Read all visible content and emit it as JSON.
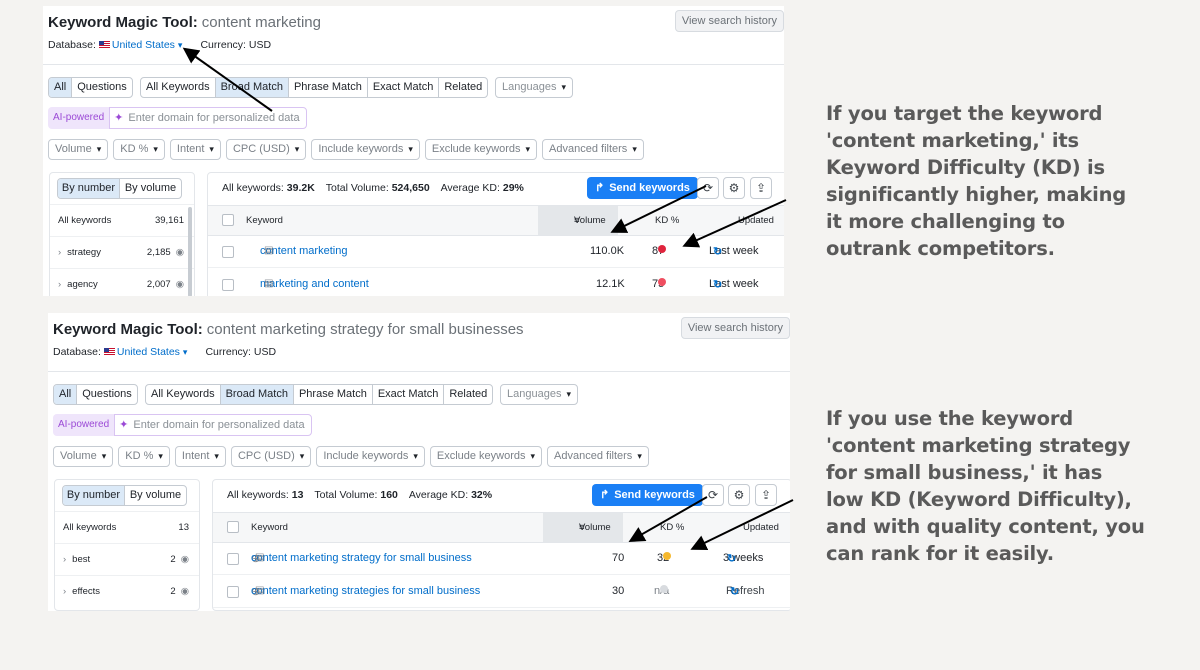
{
  "panels": [
    {
      "title": "Keyword Magic Tool:",
      "query": "content marketing",
      "history_button": "View search history",
      "database_label": "Database:",
      "database_value": "United States",
      "currency": "Currency: USD",
      "match_tabs_a": [
        "All",
        "Questions"
      ],
      "match_tabs_b": [
        "All Keywords",
        "Broad Match",
        "Phrase Match",
        "Exact Match",
        "Related"
      ],
      "languages": "Languages",
      "ai_badge": "AI-powered",
      "ai_placeholder": "Enter domain for personalized data",
      "filters": [
        "Volume",
        "KD %",
        "Intent",
        "CPC (USD)",
        "Include keywords",
        "Exclude keywords",
        "Advanced filters"
      ],
      "toggle": [
        "By number",
        "By volume"
      ],
      "side_rows": [
        {
          "label": "All keywords",
          "count": "39,161",
          "expandable": false
        },
        {
          "label": "strategy",
          "count": "2,185",
          "expandable": true
        },
        {
          "label": "agency",
          "count": "2,007",
          "expandable": true
        }
      ],
      "summary": {
        "all_label": "All keywords:",
        "all_value": "39.2K",
        "vol_label": "Total Volume:",
        "vol_value": "524,650",
        "kd_label": "Average KD:",
        "kd_value": "29%"
      },
      "send_button": "Send keywords",
      "columns": {
        "keyword": "Keyword",
        "volume": "Volume",
        "kd": "KD %",
        "updated": "Updated"
      },
      "rows": [
        {
          "keyword": "content marketing",
          "volume": "110.0K",
          "kd": "87",
          "kd_color": "#e0243d",
          "updated": "Last week"
        },
        {
          "keyword": "marketing and content",
          "volume": "12.1K",
          "kd": "75",
          "kd_color": "#ef4e60",
          "updated": "Last week"
        }
      ]
    },
    {
      "title": "Keyword Magic Tool:",
      "query": "content marketing strategy for small businesses",
      "history_button": "View search history",
      "database_label": "Database:",
      "database_value": "United States",
      "currency": "Currency: USD",
      "match_tabs_a": [
        "All",
        "Questions"
      ],
      "match_tabs_b": [
        "All Keywords",
        "Broad Match",
        "Phrase Match",
        "Exact Match",
        "Related"
      ],
      "languages": "Languages",
      "ai_badge": "AI-powered",
      "ai_placeholder": "Enter domain for personalized data",
      "filters": [
        "Volume",
        "KD %",
        "Intent",
        "CPC (USD)",
        "Include keywords",
        "Exclude keywords",
        "Advanced filters"
      ],
      "toggle": [
        "By number",
        "By volume"
      ],
      "side_rows": [
        {
          "label": "All keywords",
          "count": "13",
          "expandable": false
        },
        {
          "label": "best",
          "count": "2",
          "expandable": true
        },
        {
          "label": "effects",
          "count": "2",
          "expandable": true
        }
      ],
      "summary": {
        "all_label": "All keywords:",
        "all_value": "13",
        "vol_label": "Total Volume:",
        "vol_value": "160",
        "kd_label": "Average KD:",
        "kd_value": "32%"
      },
      "send_button": "Send keywords",
      "columns": {
        "keyword": "Keyword",
        "volume": "Volume",
        "kd": "KD %",
        "updated": "Updated"
      },
      "rows": [
        {
          "keyword": "content marketing strategy for small business",
          "volume": "70",
          "kd": "32",
          "kd_color": "#f5b82e",
          "updated": "3 weeks"
        },
        {
          "keyword": "content marketing strategies for small business",
          "volume": "30",
          "kd": "n/a",
          "kd_color": "#d8dbdf",
          "updated": "Refresh"
        }
      ]
    }
  ],
  "notes": [
    "If you target the keyword 'content marketing,' its Keyword Difficulty (KD) is significantly higher, making it more challenging to outrank competitors.",
    "If you use the keyword 'content marketing strategy for small business,' it has low KD (Keyword Difficulty), and with quality content, you can rank for it easily."
  ],
  "icons": [
    "us-flag-icon",
    "chevron-down-icon",
    "sparkle-icon",
    "eye-icon",
    "share-arrow-icon",
    "refresh-icon",
    "gear-icon",
    "export-icon",
    "sort-icon",
    "document-icon",
    "plus-circle-icon",
    "annotation-arrow-icon"
  ]
}
